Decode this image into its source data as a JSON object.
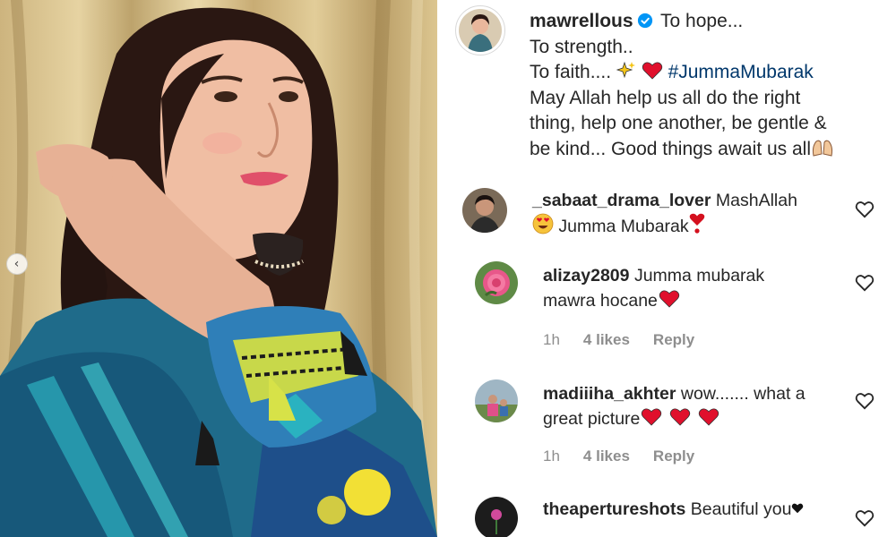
{
  "post": {
    "username": "mawrellous",
    "caption_lines": [
      "To hope...",
      "To strength..",
      "To faith....",
      "May Allah help us all do the right",
      "thing, help one another, be gentle &",
      "be kind... Good things await us all"
    ],
    "hashtag": "#JummaMubarak"
  },
  "carousel": {
    "prev_icon": "chevron-left-icon"
  },
  "comments": [
    {
      "username": "_sabaat_drama_lover",
      "text_line1": "MashAllah",
      "text_line2": "Jumma Mubarak",
      "avatar": "man-portrait"
    },
    {
      "username": "alizay2809",
      "text_line1": "Jumma mubarak",
      "text_line2": "mawra hocane",
      "time": "1h",
      "likes": "4 likes",
      "reply": "Reply",
      "avatar": "pink-rose"
    },
    {
      "username": "madiiiha_akhter",
      "text_line1": "wow....... what a",
      "text_line2": "great picture",
      "time": "1h",
      "likes": "4 likes",
      "reply": "Reply",
      "avatar": "outdoor-photo"
    },
    {
      "username": "theapertureshots",
      "text_line1": "Beautiful you",
      "avatar": "flower-dark"
    }
  ],
  "colors": {
    "text": "#262626",
    "muted": "#8e8e8e",
    "hashtag": "#00376b",
    "verified": "#0095f6",
    "heart": "#e0102c"
  }
}
